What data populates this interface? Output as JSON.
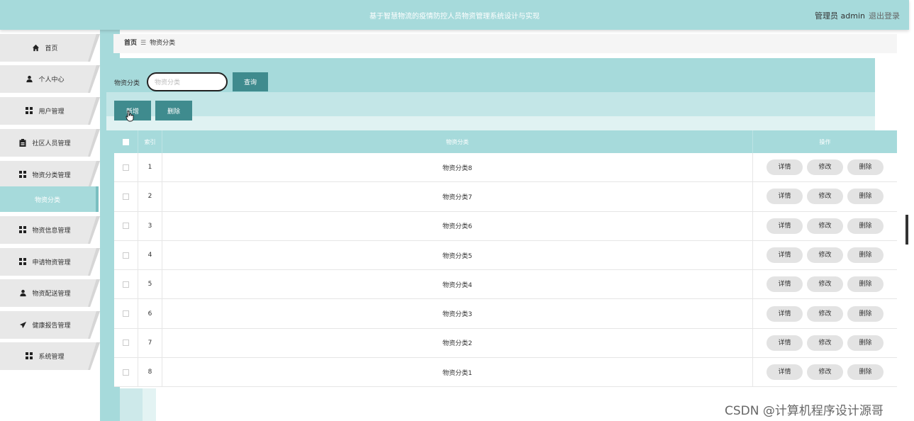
{
  "header": {
    "title": "基于智慧物流的疫情防控人员物资管理系统设计与实现",
    "user": "管理员 admin",
    "logout": "退出登录"
  },
  "sidebar": {
    "items": [
      {
        "label": "首页",
        "icon": "home-icon"
      },
      {
        "label": "个人中心",
        "icon": "user-icon"
      },
      {
        "label": "用户管理",
        "icon": "grid-icon"
      },
      {
        "label": "社区人员管理",
        "icon": "clipboard-icon"
      },
      {
        "label": "物资分类管理",
        "icon": "grid-icon"
      },
      {
        "label": "物资信息管理",
        "icon": "grid-icon"
      },
      {
        "label": "申请物资管理",
        "icon": "grid-icon"
      },
      {
        "label": "物资配送管理",
        "icon": "user-icon"
      },
      {
        "label": "健康报告管理",
        "icon": "send-icon"
      },
      {
        "label": "系统管理",
        "icon": "grid-icon"
      }
    ],
    "active_sub": "物资分类"
  },
  "breadcrumb": {
    "home": "首页",
    "separator": "☰",
    "current": "物资分类"
  },
  "search": {
    "label": "物资分类",
    "placeholder": "物资分类",
    "button": "查询"
  },
  "actions": {
    "add": "新增",
    "delete": "删除"
  },
  "table": {
    "headers": {
      "index": "索引",
      "name": "物资分类",
      "ops": "操作"
    },
    "op_labels": {
      "detail": "详情",
      "edit": "修改",
      "delete": "删除"
    },
    "rows": [
      {
        "index": "1",
        "name": "物资分类8"
      },
      {
        "index": "2",
        "name": "物资分类7"
      },
      {
        "index": "3",
        "name": "物资分类6"
      },
      {
        "index": "4",
        "name": "物资分类5"
      },
      {
        "index": "5",
        "name": "物资分类4"
      },
      {
        "index": "6",
        "name": "物资分类3"
      },
      {
        "index": "7",
        "name": "物资分类2"
      },
      {
        "index": "8",
        "name": "物资分类1"
      }
    ]
  },
  "watermark": "CSDN @计算机程序设计源哥",
  "colors": {
    "accent": "#a6dadb",
    "button": "#3f8b8e"
  }
}
